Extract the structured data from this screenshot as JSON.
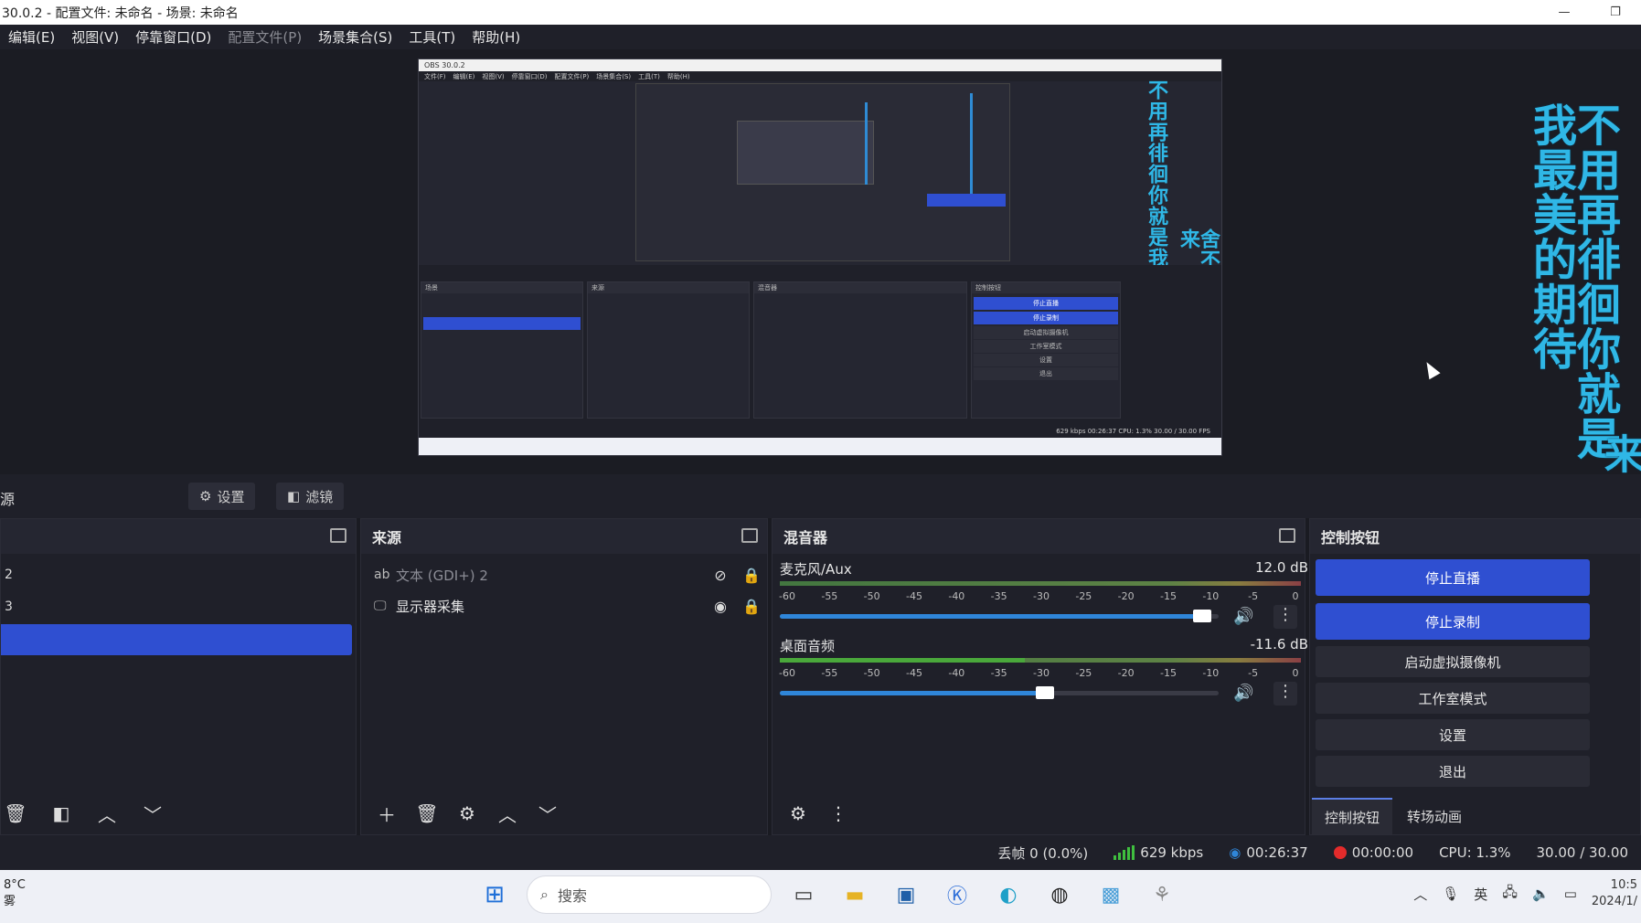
{
  "window": {
    "title": "30.0.2 - 配置文件: 未命名 - 场景: 未命名",
    "minimize": "—",
    "restore": "❐"
  },
  "menu": [
    {
      "label": "编辑(E)",
      "enabled": true
    },
    {
      "label": "视图(V)",
      "enabled": true
    },
    {
      "label": "停靠窗口(D)",
      "enabled": true
    },
    {
      "label": "配置文件(P)",
      "enabled": false
    },
    {
      "label": "场景集合(S)",
      "enabled": true
    },
    {
      "label": "工具(T)",
      "enabled": true
    },
    {
      "label": "帮助(H)",
      "enabled": true
    }
  ],
  "lyrics": {
    "line1": "不用再徘徊你就是我最美的期待",
    "line2": "舍不得分开在每一次醒来"
  },
  "preview_thumb": {
    "lyric1": "不用再徘徊你就是我最美的期待",
    "lyric2": "舍不得分开在每一次醒来",
    "stop_stream": "停止直播",
    "stop_record": "停止录制",
    "virtual_cam": "启动虚拟摄像机",
    "studio": "工作室模式",
    "settings": "设置",
    "exit": "退出",
    "status": "629 kbps   00:26:37   CPU: 1.3%   30.00 / 30.00 FPS"
  },
  "source_toolbar": {
    "label": "源",
    "settings": "设置",
    "filters": "滤镜"
  },
  "scenes": {
    "items": [
      "2",
      "3",
      ""
    ],
    "selected_index": 2
  },
  "sources": {
    "title": "来源",
    "items": [
      {
        "name": "文本 (GDI+) 2",
        "icon": "ab",
        "visible": false
      },
      {
        "name": "显示器采集",
        "icon": "monitor",
        "visible": true
      }
    ]
  },
  "mixer": {
    "title": "混音器",
    "ticks": [
      "-60",
      "-55",
      "-50",
      "-45",
      "-40",
      "-35",
      "-30",
      "-25",
      "-20",
      "-15",
      "-10",
      "-5",
      "0"
    ],
    "tracks": [
      {
        "name": "麦克风/Aux",
        "db": "12.0 dB",
        "level": 0.0,
        "volume": 0.98
      },
      {
        "name": "桌面音频",
        "db": "-11.6 dB",
        "level": 0.47,
        "volume": 0.62
      }
    ]
  },
  "controls": {
    "title": "控制按钮",
    "buttons": [
      {
        "label": "停止直播",
        "primary": true
      },
      {
        "label": "停止录制",
        "primary": true
      },
      {
        "label": "启动虚拟摄像机",
        "primary": false
      },
      {
        "label": "工作室模式",
        "primary": false
      },
      {
        "label": "设置",
        "primary": false
      },
      {
        "label": "退出",
        "primary": false
      }
    ],
    "tabs": [
      "控制按钮",
      "转场动画"
    ]
  },
  "status": {
    "dropped": "丢帧 0 (0.0%)",
    "bitrate": "629 kbps",
    "stream_time": "00:26:37",
    "rec_time": "00:00:00",
    "cpu": "CPU: 1.3%",
    "fps": "30.00 / 30.00"
  },
  "taskbar": {
    "temp": "8°C",
    "weather": "雾",
    "search_placeholder": "搜索",
    "ime": "英",
    "time": "10:5",
    "date": "2024/1/"
  },
  "colors": {
    "accent": "#2f4fd1",
    "lyric": "#2fb7e6",
    "record": "#e32b2b"
  }
}
